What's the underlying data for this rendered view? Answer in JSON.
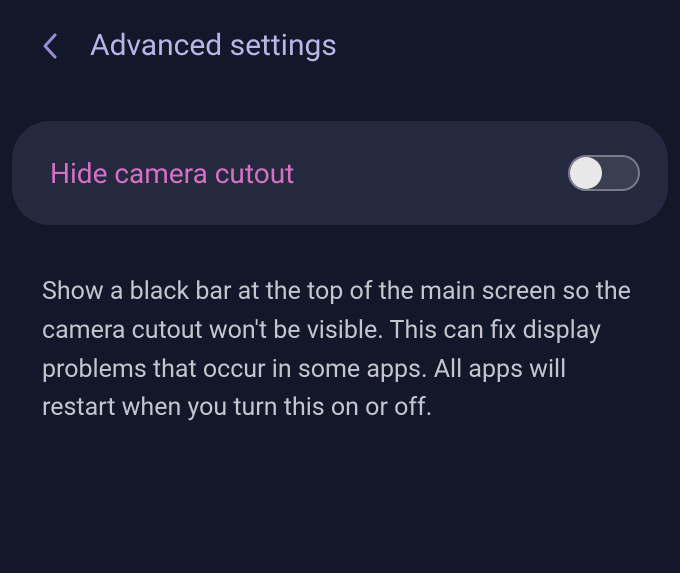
{
  "header": {
    "title": "Advanced settings"
  },
  "setting": {
    "title": "Hide camera cutout",
    "toggle_state": false
  },
  "description": "Show a black bar at the top of the main screen so the camera cutout won't be visible. This can fix display problems that occur in some apps. All apps will restart when you turn this on or off."
}
